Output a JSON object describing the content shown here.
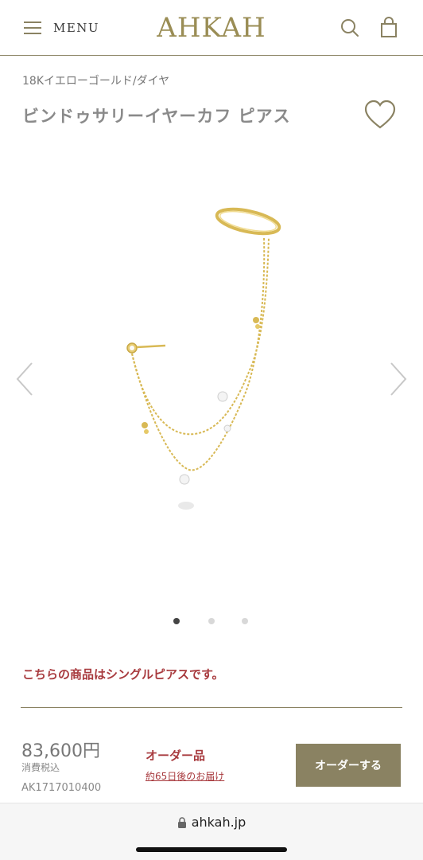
{
  "header": {
    "menu_label": "MENU",
    "logo": "AHKAH",
    "icons": [
      "hamburger-icon",
      "search-icon",
      "shopping-bag-icon"
    ],
    "accent_color": "#8a8262"
  },
  "product": {
    "category": "18Kイエローゴールド/ダイヤ",
    "title": "ビンドゥサリーイヤーカフ ピアス",
    "notice": "こちらの商品はシングルピアスです。",
    "price": "83,600円",
    "tax_note": "消費税込",
    "sku": "AK1717010400",
    "order_type": "オーダー品",
    "delivery": "約65日後のお届け",
    "order_button": "オーダーする"
  },
  "gallery": {
    "slide_count": 3,
    "active_slide": 1
  },
  "browser": {
    "url": "ahkah.jp"
  }
}
